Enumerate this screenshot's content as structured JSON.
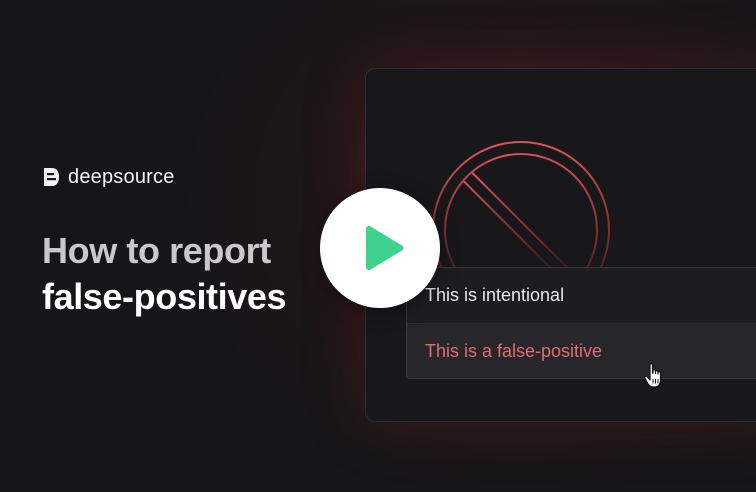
{
  "brand": {
    "name": "deepsource",
    "logo_icon": "deepsource-logo-icon"
  },
  "headline": {
    "line1": "How to report",
    "line2": "false-positives"
  },
  "menu": {
    "items": [
      {
        "label": "This is intentional"
      },
      {
        "label": "This is a false-positive"
      }
    ]
  },
  "icons": {
    "ban": "ban-icon",
    "cursor": "hand-pointer-icon",
    "play": "play-icon"
  },
  "colors": {
    "accent_red": "#e26b6f",
    "play_green": "#3fd28f",
    "background": "#161618"
  }
}
